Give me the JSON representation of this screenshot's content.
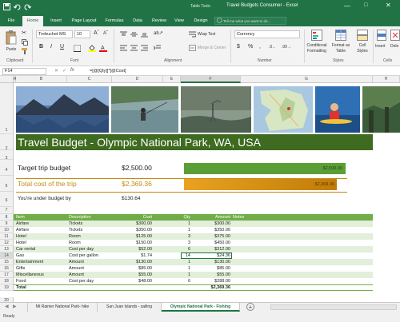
{
  "window": {
    "context_tab": "Table Tools",
    "title": "Travel Budgets Consumer - Excel"
  },
  "tabs": [
    "File",
    "Home",
    "Insert",
    "Page Layout",
    "Formulas",
    "Data",
    "Review",
    "View",
    "Design"
  ],
  "tell_me": "Tell me what you want to do...",
  "ribbon": {
    "paste": "Paste",
    "font_name": "Trebuchet MS",
    "font_size": "10",
    "wrap_text": "Wrap Text",
    "merge_center": "Merge & Center",
    "number_format": "Currency",
    "conditional_formatting": "Conditional Formatting",
    "format_as_table": "Format as Table",
    "cell_styles": "Cell Styles",
    "insert": "Insert",
    "delete": "Dele",
    "groups": {
      "clipboard": "Clipboard",
      "font": "Font",
      "alignment": "Alignment",
      "number": "Number",
      "styles": "Styles",
      "cells": "Cells"
    }
  },
  "formula_bar": {
    "name_box": "F14",
    "formula": "=[@[Qty]]*[@Cost]"
  },
  "columns": [
    "A",
    "B",
    "C",
    "D",
    "E",
    "F",
    "G",
    "H"
  ],
  "sheet": {
    "title": "Travel Budget - Olympic National Park, WA, USA",
    "target_label": "Target trip budget",
    "target_value": "$2,500.00",
    "target_bar_value": "$2,500.00",
    "total_label": "Total cost of the trip",
    "total_value": "$2,369.36",
    "total_bar_value": "$2,369.36",
    "under_label": "You're under budget by",
    "under_value": "$130.64",
    "bar_fill_fraction": 0.948,
    "table_headers": [
      "Item",
      "Description",
      "Cost",
      "Qty",
      "Amount",
      "Notes"
    ],
    "table_rows": [
      {
        "row": "9",
        "item": "Airfare",
        "desc": "Tickets",
        "cost": "$300.00",
        "qty": "1",
        "amount": "$300.00"
      },
      {
        "row": "10",
        "item": "Airfare",
        "desc": "Tickets",
        "cost": "$350.00",
        "qty": "1",
        "amount": "$350.00"
      },
      {
        "row": "11",
        "item": "Hotel",
        "desc": "Room",
        "cost": "$125.00",
        "qty": "3",
        "amount": "$375.00"
      },
      {
        "row": "12",
        "item": "Hotel",
        "desc": "Room",
        "cost": "$150.00",
        "qty": "3",
        "amount": "$450.00"
      },
      {
        "row": "13",
        "item": "Car rental",
        "desc": "Cost per day",
        "cost": "$52.00",
        "qty": "6",
        "amount": "$312.00"
      },
      {
        "row": "14",
        "item": "Gas",
        "desc": "Cost per gallon",
        "cost": "$1.74",
        "qty": "14",
        "amount": "$24.36"
      },
      {
        "row": "15",
        "item": "Entertainment",
        "desc": "Amount",
        "cost": "$130.00",
        "qty": "1",
        "amount": "$130.00"
      },
      {
        "row": "16",
        "item": "Gifts",
        "desc": "Amount",
        "cost": "$85.00",
        "qty": "1",
        "amount": "$85.00"
      },
      {
        "row": "17",
        "item": "Miscellaneous",
        "desc": "Amount",
        "cost": "$55.00",
        "qty": "1",
        "amount": "$55.00"
      },
      {
        "row": "18",
        "item": "Food",
        "desc": "Cost per day",
        "cost": "$48.00",
        "qty": "6",
        "amount": "$288.00"
      }
    ],
    "total_row": {
      "row": "19",
      "label": "Total",
      "amount": "$2,369.36"
    }
  },
  "row_numbers": [
    "1",
    "2",
    "3",
    "4",
    "5",
    "6",
    "7",
    "8",
    "20"
  ],
  "sheet_tabs": [
    "Mt Rainier National Park- hike",
    "San Juan Islands - sailing",
    "Olympic National Park - Fishing"
  ],
  "status": "Ready",
  "colors": {
    "excel_green": "#217346",
    "title_band": "#3e6b1f",
    "header_green": "#70ad47",
    "band_light": "#e2efda",
    "gold": "#c58a10"
  }
}
